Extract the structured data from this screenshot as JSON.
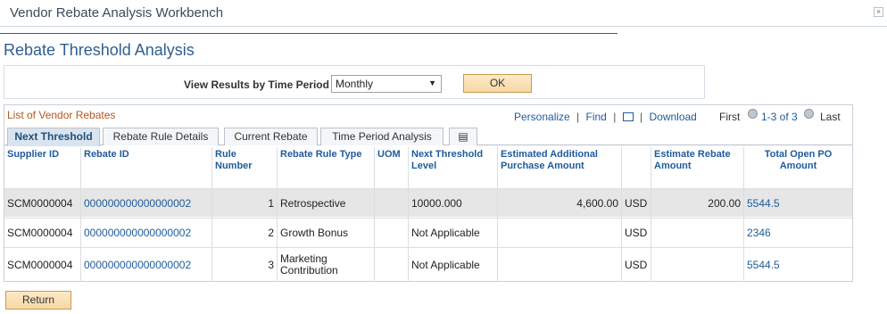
{
  "window": {
    "title": "Vendor Rebate Analysis Workbench",
    "close_glyph": "×"
  },
  "page": {
    "title": "Rebate Threshold Analysis"
  },
  "filter": {
    "label": "View Results by Time Period",
    "selected": "Monthly",
    "ok_label": "OK"
  },
  "grid": {
    "title": "List of Vendor Rebates",
    "personalize": "Personalize",
    "find": "Find",
    "download": "Download",
    "first": "First",
    "range": "1-3 of 3",
    "last": "Last",
    "tabs": [
      "Next Threshold",
      "Rebate Rule Details",
      "Current Rebate",
      "Time Period Analysis"
    ],
    "columns": [
      "Supplier ID",
      "Rebate ID",
      "Rule Number",
      "Rebate Rule Type",
      "UOM",
      "Next Threshold Level",
      "Estimated Additional Purchase Amount",
      "",
      "Estimate Rebate Amount",
      "Total Open PO Amount"
    ],
    "rows": [
      {
        "supplier": "SCM0000004",
        "rebate": "000000000000000002",
        "rule": "1",
        "type": "Retrospective",
        "uom": "",
        "next": "10000.000",
        "est_add": "4,600.00",
        "cur": "USD",
        "est_rebate": "200.00",
        "open_po": "5544.5"
      },
      {
        "supplier": "SCM0000004",
        "rebate": "000000000000000002",
        "rule": "2",
        "type": "Growth Bonus",
        "uom": "",
        "next": "Not Applicable",
        "est_add": "",
        "cur": "USD",
        "est_rebate": "",
        "open_po": "2346"
      },
      {
        "supplier": "SCM0000004",
        "rebate": "000000000000000002",
        "rule": "3",
        "type": "Marketing Contribution",
        "uom": "",
        "next": "Not Applicable",
        "est_add": "",
        "cur": "USD",
        "est_rebate": "",
        "open_po": "5544.5"
      }
    ]
  },
  "footer": {
    "return_label": "Return"
  }
}
